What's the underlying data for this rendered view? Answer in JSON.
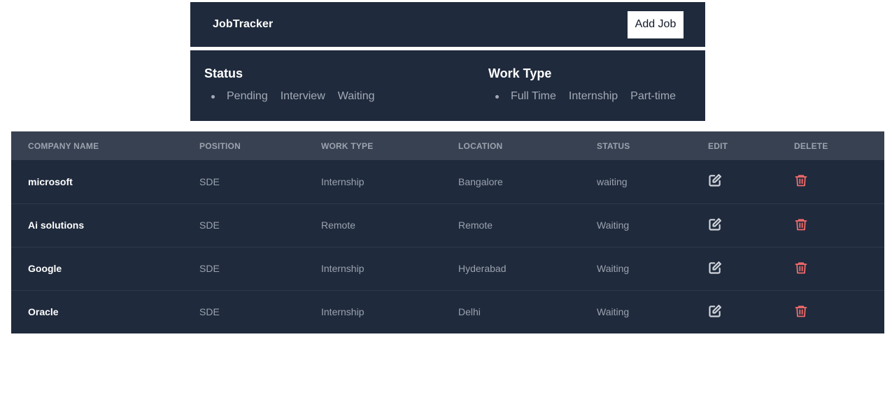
{
  "navbar": {
    "brand": "JobTracker",
    "add_button": "Add Job"
  },
  "filters": {
    "status": {
      "title": "Status",
      "items": [
        "Pending",
        "Interview",
        "Waiting"
      ]
    },
    "work_type": {
      "title": "Work Type",
      "items": [
        "Full Time",
        "Internship",
        "Part-time"
      ]
    }
  },
  "table": {
    "columns": [
      "COMPANY NAME",
      "POSITION",
      "WORK TYPE",
      "LOCATION",
      "STATUS",
      "EDIT",
      "DELETE"
    ],
    "rows": [
      {
        "company": "microsoft",
        "position": "SDE",
        "work_type": "Internship",
        "location": "Bangalore",
        "status": "waiting"
      },
      {
        "company": "Ai solutions",
        "position": "SDE",
        "work_type": "Remote",
        "location": "Remote",
        "status": "Waiting"
      },
      {
        "company": "Google",
        "position": "SDE",
        "work_type": "Internship",
        "location": "Hyderabad",
        "status": "Waiting"
      },
      {
        "company": "Oracle",
        "position": "SDE",
        "work_type": "Internship",
        "location": "Delhi",
        "status": "Waiting"
      }
    ]
  },
  "icons": {
    "edit": "edit-icon",
    "delete": "trash-icon"
  },
  "colors": {
    "panel_bg": "#1f2a3c",
    "header_row_bg": "#374151",
    "delete_icon": "#f26b6b",
    "edit_icon": "#d1d5db"
  }
}
